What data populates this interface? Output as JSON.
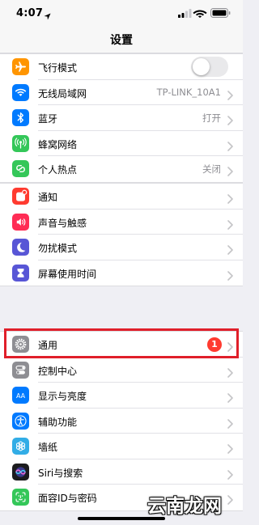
{
  "status_bar": {
    "time": "4:07"
  },
  "nav": {
    "title": "设置"
  },
  "groups": [
    {
      "items": [
        {
          "label": "飞行模式",
          "icon": "airplane-icon",
          "icon_bg": "#ff9500",
          "control": "toggle",
          "toggle_on": false
        },
        {
          "label": "无线局域网",
          "icon": "wifi-icon",
          "icon_bg": "#007aff",
          "value": "TP-LINK_10A1"
        },
        {
          "label": "蓝牙",
          "icon": "bluetooth-icon",
          "icon_bg": "#007aff",
          "value": "打开"
        },
        {
          "label": "蜂窝网络",
          "icon": "cellular-icon",
          "icon_bg": "#34c759"
        },
        {
          "label": "个人热点",
          "icon": "hotspot-icon",
          "icon_bg": "#34c759",
          "value": "关闭"
        }
      ]
    },
    {
      "items": [
        {
          "label": "通知",
          "icon": "notifications-icon",
          "icon_bg": "#ff3b30"
        },
        {
          "label": "声音与触感",
          "icon": "sounds-icon",
          "icon_bg": "#ff2d55"
        },
        {
          "label": "勿扰模式",
          "icon": "moon-icon",
          "icon_bg": "#5856d6"
        },
        {
          "label": "屏幕使用时间",
          "icon": "hourglass-icon",
          "icon_bg": "#5856d6"
        }
      ]
    },
    {
      "items": [
        {
          "label": "通用",
          "icon": "gear-icon",
          "icon_bg": "#8e8e93",
          "badge": "1"
        },
        {
          "label": "控制中心",
          "icon": "control-center-icon",
          "icon_bg": "#8e8e93"
        },
        {
          "label": "显示与亮度",
          "icon": "display-icon",
          "icon_bg": "#007aff"
        },
        {
          "label": "辅助功能",
          "icon": "accessibility-icon",
          "icon_bg": "#007aff"
        },
        {
          "label": "墙纸",
          "icon": "wallpaper-icon",
          "icon_bg": "#32ade6"
        },
        {
          "label": "Siri与搜索",
          "icon": "siri-icon",
          "icon_bg": "#1c1c1e"
        },
        {
          "label": "面容ID与密码",
          "icon": "faceid-icon",
          "icon_bg": "#34c759"
        }
      ]
    }
  ],
  "watermark": {
    "text": "云南龙网"
  }
}
